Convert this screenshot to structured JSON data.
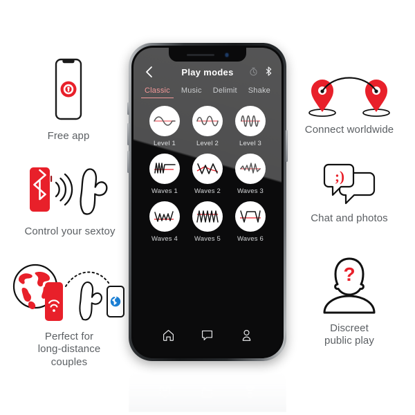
{
  "theme": {
    "brand_red": "#e8202a",
    "accent_salmon": "#f07070",
    "caption_gray": "#5b5f63",
    "screen_black": "#0b0b0c"
  },
  "phone": {
    "statusbar": {
      "speaker": "earpiece-speaker",
      "camera": "front-camera"
    },
    "appbar": {
      "back_icon": "chevron-left-icon",
      "title": "Play modes",
      "icons": [
        {
          "name": "timer-icon",
          "label": "Timer"
        },
        {
          "name": "bluetooth-icon",
          "label": "Bluetooth"
        }
      ]
    },
    "tabs": [
      {
        "label": "Classic",
        "active": true
      },
      {
        "label": "Music",
        "active": false
      },
      {
        "label": "Delimit",
        "active": false
      },
      {
        "label": "Shake",
        "active": false
      }
    ],
    "modes": [
      {
        "label": "Level 1",
        "wave": "sine-low"
      },
      {
        "label": "Level 2",
        "wave": "sine-mid"
      },
      {
        "label": "Level 3",
        "wave": "sine-high"
      },
      {
        "label": "Waves 1",
        "wave": "burst-then-flat"
      },
      {
        "label": "Waves 2",
        "wave": "wide-zigzag"
      },
      {
        "label": "Waves 3",
        "wave": "dense-zigzag"
      },
      {
        "label": "Waves 4",
        "wave": "tapered-zigzag"
      },
      {
        "label": "Waves 5",
        "wave": "sawtooth-peaks"
      },
      {
        "label": "Waves 6",
        "wave": "trapezoid-plateau"
      }
    ],
    "navbar": [
      {
        "name": "home-icon",
        "label": "Home"
      },
      {
        "name": "chat-icon",
        "label": "Chat"
      },
      {
        "name": "profile-icon",
        "label": "Profile"
      }
    ]
  },
  "features": {
    "free_app": {
      "caption": "Free app",
      "art": "phone-with-app-logo"
    },
    "control": {
      "caption": "Control your sextoy",
      "art": "phone-bluetooth-to-toy"
    },
    "distance": {
      "caption": "Perfect for\nlong-distance\ncouples",
      "art": "globe-phone-toy-phone"
    },
    "connect": {
      "caption": "Connect worldwide",
      "art": "two-map-pins-arc"
    },
    "chat": {
      "caption": "Chat and photos",
      "art": "two-speech-bubbles-wink",
      "emoticon": ";)"
    },
    "discreet": {
      "caption": "Discreet\npublic play",
      "art": "person-with-question-mark",
      "symbol": "?"
    }
  }
}
